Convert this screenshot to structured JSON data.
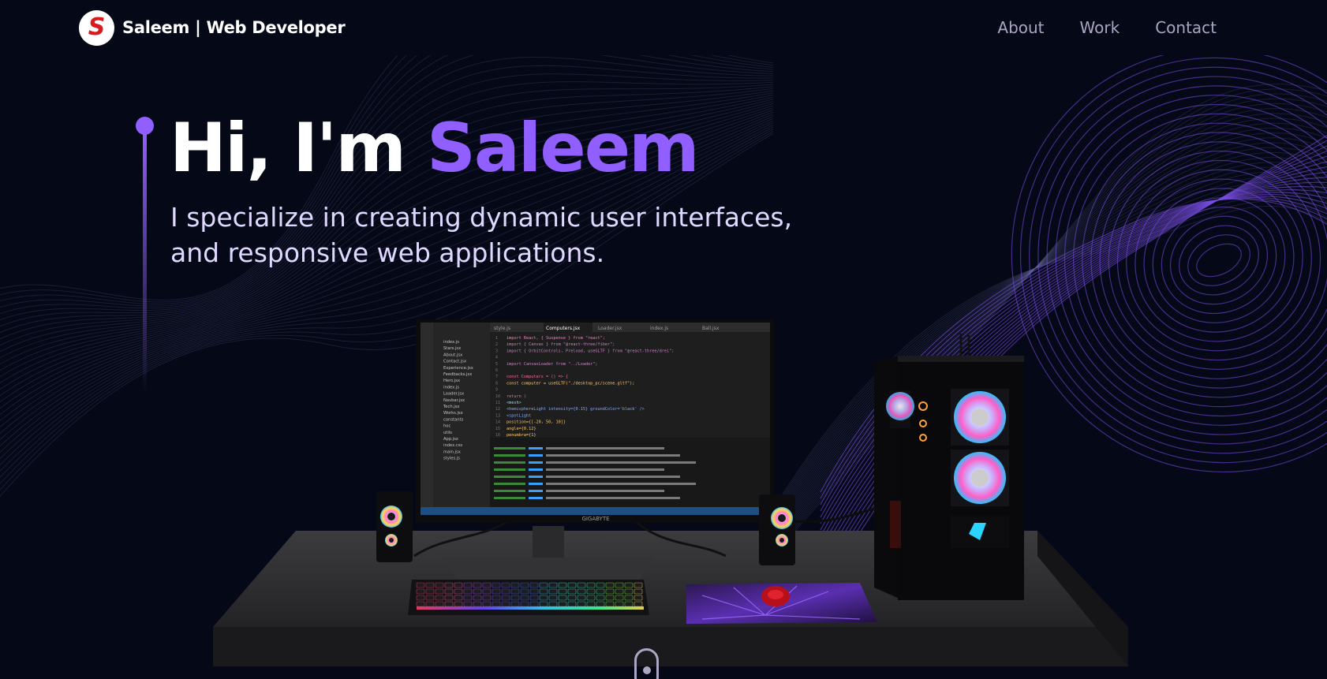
{
  "navbar": {
    "logo_letter": "S",
    "brand": "Saleem | Web Developer",
    "links": [
      {
        "label": "About"
      },
      {
        "label": "Work"
      },
      {
        "label": "Contact"
      }
    ]
  },
  "hero": {
    "greeting": "Hi, I'm ",
    "name": "Saleem",
    "subtitle": "I specialize in creating dynamic user interfaces, and responsive web applications."
  },
  "scene": {
    "monitor_brand": "GIGABYTE",
    "editor_tabs": [
      "style.js",
      "Computers.jsx",
      "Loader.jsx",
      "index.js",
      "Ball.jsx"
    ],
    "code_lines": [
      "import React, { Suspense } from \"react\";",
      "import { Canvas } from \"@react-three/fiber\";",
      "import { OrbitControls, Preload, useGLTF } from \"@react-three/drei\";",
      "",
      "import CanvasLoader from \"../Loader\";",
      "",
      "const Computers = () => {",
      "  const computer = useGLTF(\"./desktop_pc/scene.gltf\");",
      "",
      "  return (",
      "    <mesh>",
      "      <hemisphereLight intensity={0.15} groundColor='black' />",
      "      <spotLight",
      "        position={[-20, 50, 10]}",
      "        angle={0.12}",
      "        penumbra={1}"
    ],
    "file_tree": [
      "index.js",
      "Stars.jsx",
      "About.jsx",
      "Contact.jsx",
      "Experience.jsx",
      "Feedbacks.jsx",
      "Hero.jsx",
      "index.js",
      "Loader.jsx",
      "Navbar.jsx",
      "Tech.jsx",
      "Works.jsx",
      "constants",
      "hoc",
      "utils",
      "App.jsx",
      "index.css",
      "main.jsx",
      "styles.js"
    ]
  },
  "colors": {
    "background": "#050816",
    "accent": "#915eff",
    "nav_text": "#aaa6c3",
    "logo_red": "#d71920"
  }
}
